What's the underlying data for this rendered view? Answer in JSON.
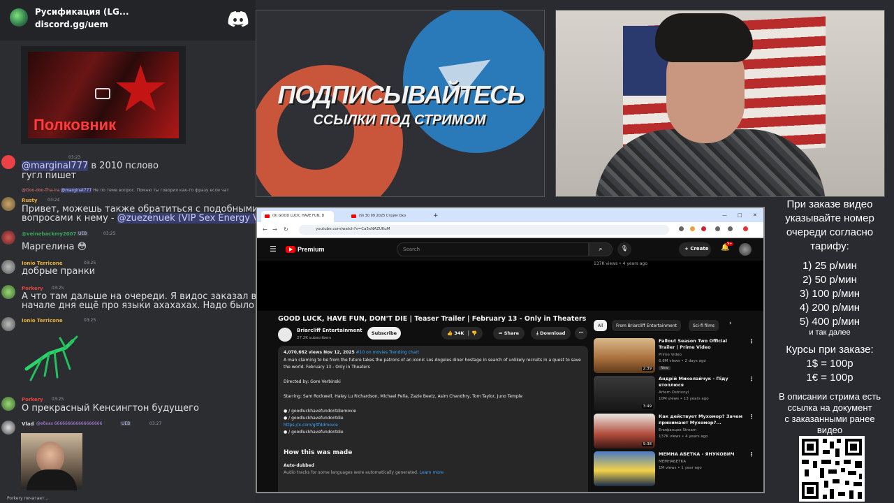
{
  "server": {
    "name": "Русификация (LG...",
    "invite": "discord.gg/uem"
  },
  "chat": {
    "image_title": "Полковник",
    "messages": [
      {
        "id": "m1",
        "user": "",
        "time": "03:23",
        "text_mention": "@marginal777",
        "text": " в 2010 пслово",
        "text2": "гугл пишет"
      },
      {
        "id": "m2",
        "reply_user": "@Goo-doo-Tha-ira",
        "reply_mention": "@marginal777",
        "reply_text": "Не по теме вопрос. Помню ты говорил как-то фразу если чат",
        "user": "Rusty",
        "time": "03:24",
        "text": "Привет, можешь также обратиться с подобными",
        "text2": "вопросами к нему - ",
        "mention2": "@zuezenuek (VIP Sex Energy VIP)"
      },
      {
        "id": "m3",
        "user": "@veinebackmy2007",
        "badge": "UEB",
        "time": "03:25",
        "text": "Маргелина 😳"
      },
      {
        "id": "m4",
        "user": "Ionio Terricone",
        "time": "03:25",
        "text": "добрые пранки"
      },
      {
        "id": "m5",
        "user": "Porkery",
        "time": "03:25",
        "text": "А что там дальше на очереди. Я видос заказал в",
        "text2": "начале дня ещё про языки ахахахах. Надо было по 5"
      },
      {
        "id": "m6",
        "user": "Ionio Terricone",
        "time": "03:25"
      },
      {
        "id": "m7",
        "user": "Porkery",
        "time": "03:25",
        "text": "О прекрасный Кенсингтон будущего"
      },
      {
        "id": "m8",
        "user": "Vlad",
        "user_extra": "@ебкаs 666666666666666666",
        "badge": "UEB",
        "time": "03:27"
      }
    ],
    "typing": "Porkery печатает..."
  },
  "promo": {
    "title": "ПОДПИСЫВАЙТЕСЬ",
    "subtitle": "ССЫЛКИ ПОД СТРИМОМ"
  },
  "browser": {
    "tabs": [
      {
        "label": "(9) GOOD LUCK, HAVE FUN, D",
        "active": true
      },
      {
        "label": "(9) 30 09 2025 Стрим Охо",
        "active": false
      }
    ],
    "url": "youtube.com/watch?v=Ca5xNAZUKuM"
  },
  "youtube": {
    "brand": "Premium",
    "search_placeholder": "Search",
    "create_label": "Create",
    "notif_count": "9+",
    "top_views": "137K views • 4 years ago",
    "video_title": "GOOD LUCK, HAVE FUN, DON'T DIE | Teaser Trailer | February 13 - Only in Theaters",
    "channel": "Briarcliff Entertainment",
    "subs": "27.2K subscribers",
    "subscribe_label": "Subscribe",
    "likes": "34K",
    "share_label": "Share",
    "download_label": "Download",
    "description": {
      "views_date": "4,070,662 views  Nov 12, 2025",
      "trending": "#10 on movies Trending chart",
      "summary": "A man claiming to be from the future takes the patrons of an iconic Los Angeles diner hostage in search of unlikely recruits in a quest to save the world. February 13 - Only in Theaters",
      "directed": "Directed by: Gore Verbinski",
      "starring": "Starring: Sam Rockwell, Haley Lu Richardson, Michael Peña, Zazie Beetz, Asim Chandhry, Tom Taylor, Juno Temple",
      "links": [
        "/ goodluckhavefundontdiemovie",
        "/ goodluckhavefundontdie",
        "https://x.com/gltfddmovie",
        "/ goodluckhavefundontdie"
      ],
      "how_made": "How this was made",
      "auto_dubbed": "Auto-dubbed",
      "auto_text": "Audio tracks for some languages were automatically generated.",
      "learn_more": "Learn more"
    },
    "chips": [
      "All",
      "From Briarcliff Entertainment",
      "Sci-fi films"
    ],
    "recommendations": [
      {
        "title": "Fallout Season Two Official Trailer | Prime Video",
        "channel": "Prime Video",
        "meta": "6.8M views • 2 days ago",
        "duration": "2:39",
        "new": "New"
      },
      {
        "title": "Андрій Миколайчук - Піду втоплюся",
        "channel": "Artem Ostrivnyi",
        "meta": "10M views • 13 years ago",
        "duration": "3:49"
      },
      {
        "title": "Как действует Мухомор? Зачем принимают Мухомор?...",
        "channel": "Елифанцев Stream",
        "meta": "137K views • 4 years ago",
        "duration": "9:38"
      },
      {
        "title": "МЕМНА АБЕТКА - ЯНУКОВИЧ",
        "channel": "МЕМНАБЕТКА",
        "meta": "1M views • 1 year ago",
        "duration": ""
      }
    ]
  },
  "info": {
    "l1": "При заказе видео",
    "l2": "указывайте номер",
    "l3": "очереди согласно",
    "l4": "тарифу:",
    "tariffs": [
      "1) 25 р/мин",
      "2) 50 р/мин",
      "3) 100 р/мин",
      "4) 200 р/мин",
      "5) 400 р/мин"
    ],
    "etc": "и так далее",
    "courses": "Курсы при заказе:",
    "usd": "1$ = 100р",
    "eur": "1€ = 100р",
    "d1": "В описании стрима есть",
    "d2": "ссылка на документ",
    "d3": "с заказанными ранее",
    "d4": "видео"
  },
  "colors": {
    "discord": "#5865f2",
    "youtube_red": "#ff0000",
    "mention": "#c9cdfb"
  }
}
